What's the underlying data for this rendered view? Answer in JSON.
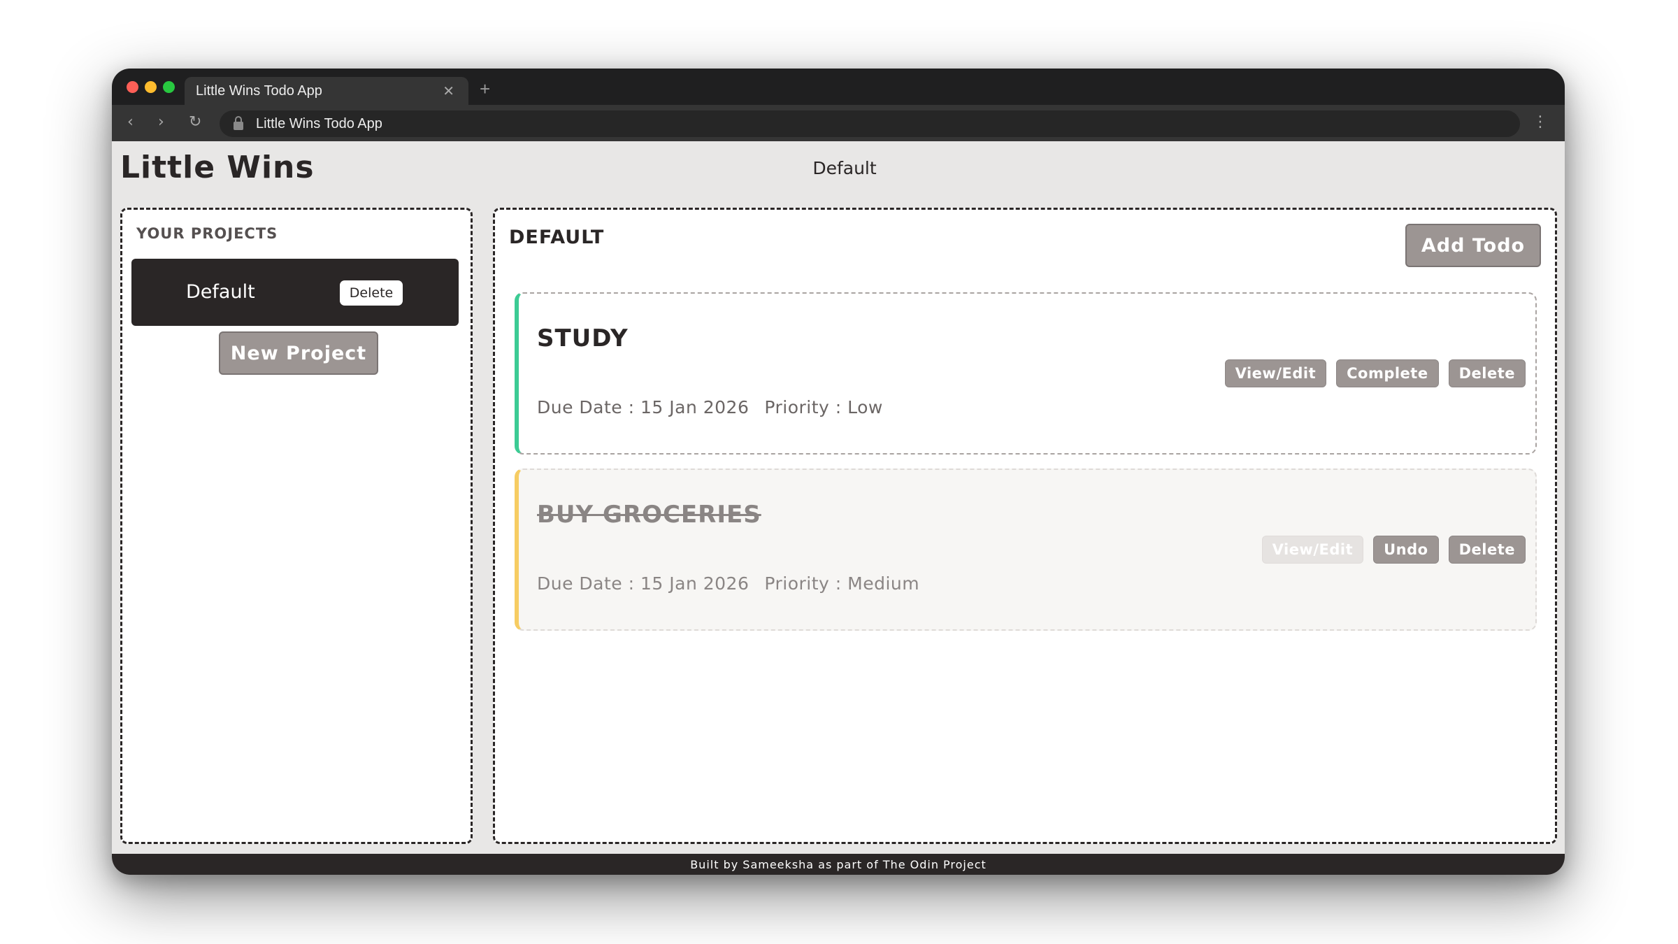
{
  "browser": {
    "tab_title": "Little Wins Todo App",
    "tab_close": "✕",
    "new_tab": "+",
    "url": "Little Wins Todo App",
    "back": "‹",
    "forward": "›",
    "reload": "↻",
    "menu": "⋮"
  },
  "header": {
    "app_title": "Little Wins",
    "current_project": "Default"
  },
  "sidebar": {
    "heading": "YOUR PROJECTS",
    "projects": [
      {
        "name": "Default",
        "delete_label": "Delete"
      }
    ],
    "new_project_label": "New Project"
  },
  "main": {
    "heading": "DEFAULT",
    "add_todo_label": "Add Todo",
    "todos": [
      {
        "title": "STUDY",
        "due_date": "Due Date : 15 Jan 2026",
        "priority": "Priority : Low",
        "priority_color": "#3ccb94",
        "completed": false,
        "actions": [
          "View/Edit",
          "Complete",
          "Delete"
        ]
      },
      {
        "title": "BUY GROCERIES",
        "due_date": "Due Date : 15 Jan 2026",
        "priority": "Priority : Medium",
        "priority_color": "#f6cc62",
        "completed": true,
        "actions": [
          "View/Edit",
          "Undo",
          "Delete"
        ]
      }
    ]
  },
  "footer": {
    "text": "Built by Sameeksha as part of The Odin Project"
  }
}
